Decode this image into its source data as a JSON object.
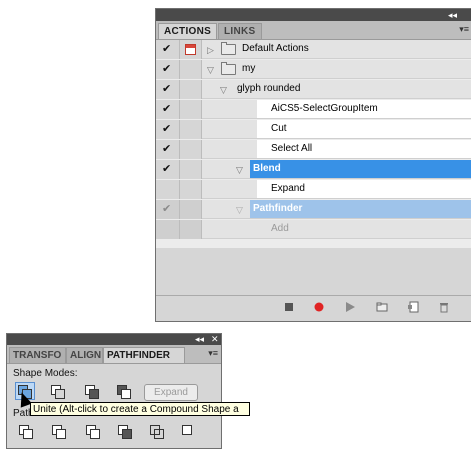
{
  "actions_panel": {
    "tabs": [
      "ACTIONS",
      "LINKS"
    ],
    "window_controls": "◂◂ ✕",
    "menu_icon": "menu-icon",
    "rows": [
      {
        "label": "Default Actions",
        "type": "set",
        "expanded": false,
        "checked": true,
        "dialog": true
      },
      {
        "label": "my",
        "type": "set",
        "expanded": true,
        "checked": true,
        "dialog": false
      },
      {
        "label": "glyph rounded",
        "type": "action",
        "expanded": true,
        "checked": true
      },
      {
        "label": "AiCS5-SelectGroupItem",
        "type": "step",
        "checked": true
      },
      {
        "label": "Cut",
        "type": "step",
        "checked": true
      },
      {
        "label": "Select All",
        "type": "step",
        "checked": true
      },
      {
        "label": "Blend",
        "type": "action",
        "expanded": true,
        "checked": true,
        "selected": true
      },
      {
        "label": "Expand",
        "type": "step",
        "checked": false
      },
      {
        "label": "Pathfinder",
        "type": "action",
        "expanded": true,
        "checked": true,
        "dim": true
      },
      {
        "label": "Add",
        "type": "step",
        "dim": true
      }
    ],
    "bottom_icons": [
      "stop-icon",
      "record-icon",
      "play-icon",
      "new-set-icon",
      "new-action-icon",
      "trash-icon"
    ]
  },
  "pathfinder_panel": {
    "tabs": [
      "TRANSFO",
      "ALIGN",
      "PATHFINDER"
    ],
    "shape_modes_label": "Shape Modes:",
    "expand_label": "Expand",
    "pathfinders_label": "Path",
    "tooltip": "Unite (Alt-click to create a Compound Shape a"
  },
  "colors": {
    "selection": "#3891e6",
    "selection_dim": "#9ec3ea",
    "panel": "#d6d6d6",
    "titlebar": "#4a4a4a",
    "record": "#e02424"
  }
}
